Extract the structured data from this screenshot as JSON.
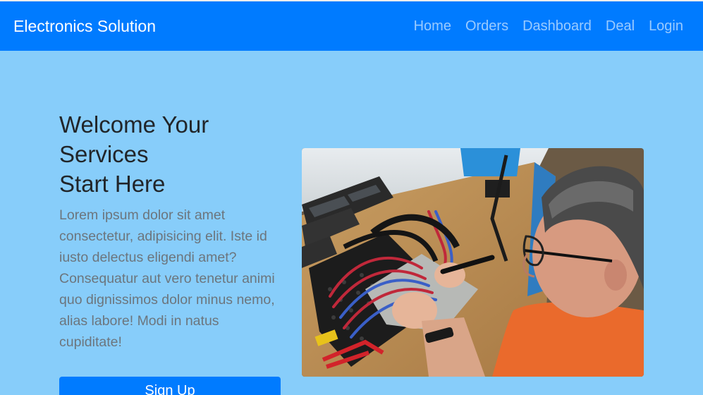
{
  "navbar": {
    "brand": "Electronics Solution",
    "links": [
      "Home",
      "Orders",
      "Dashboard",
      "Deal",
      "Login"
    ],
    "color": "#007bff"
  },
  "hero": {
    "title_lines": [
      "Welcome Your",
      "Services",
      "Start Here"
    ],
    "description": "Lorem ipsum dolor sit amet consectetur, adipisicing elit. Iste id iusto delectus eligendi amet? Consequatur aut vero tenetur animi quo dignissimos dolor minus nemo, alias labore! Modi in natus cupiditate!",
    "signup_label": "Sign Up",
    "background": "#87cdfa"
  },
  "image": {
    "icon": "photo-technician-soldering"
  }
}
